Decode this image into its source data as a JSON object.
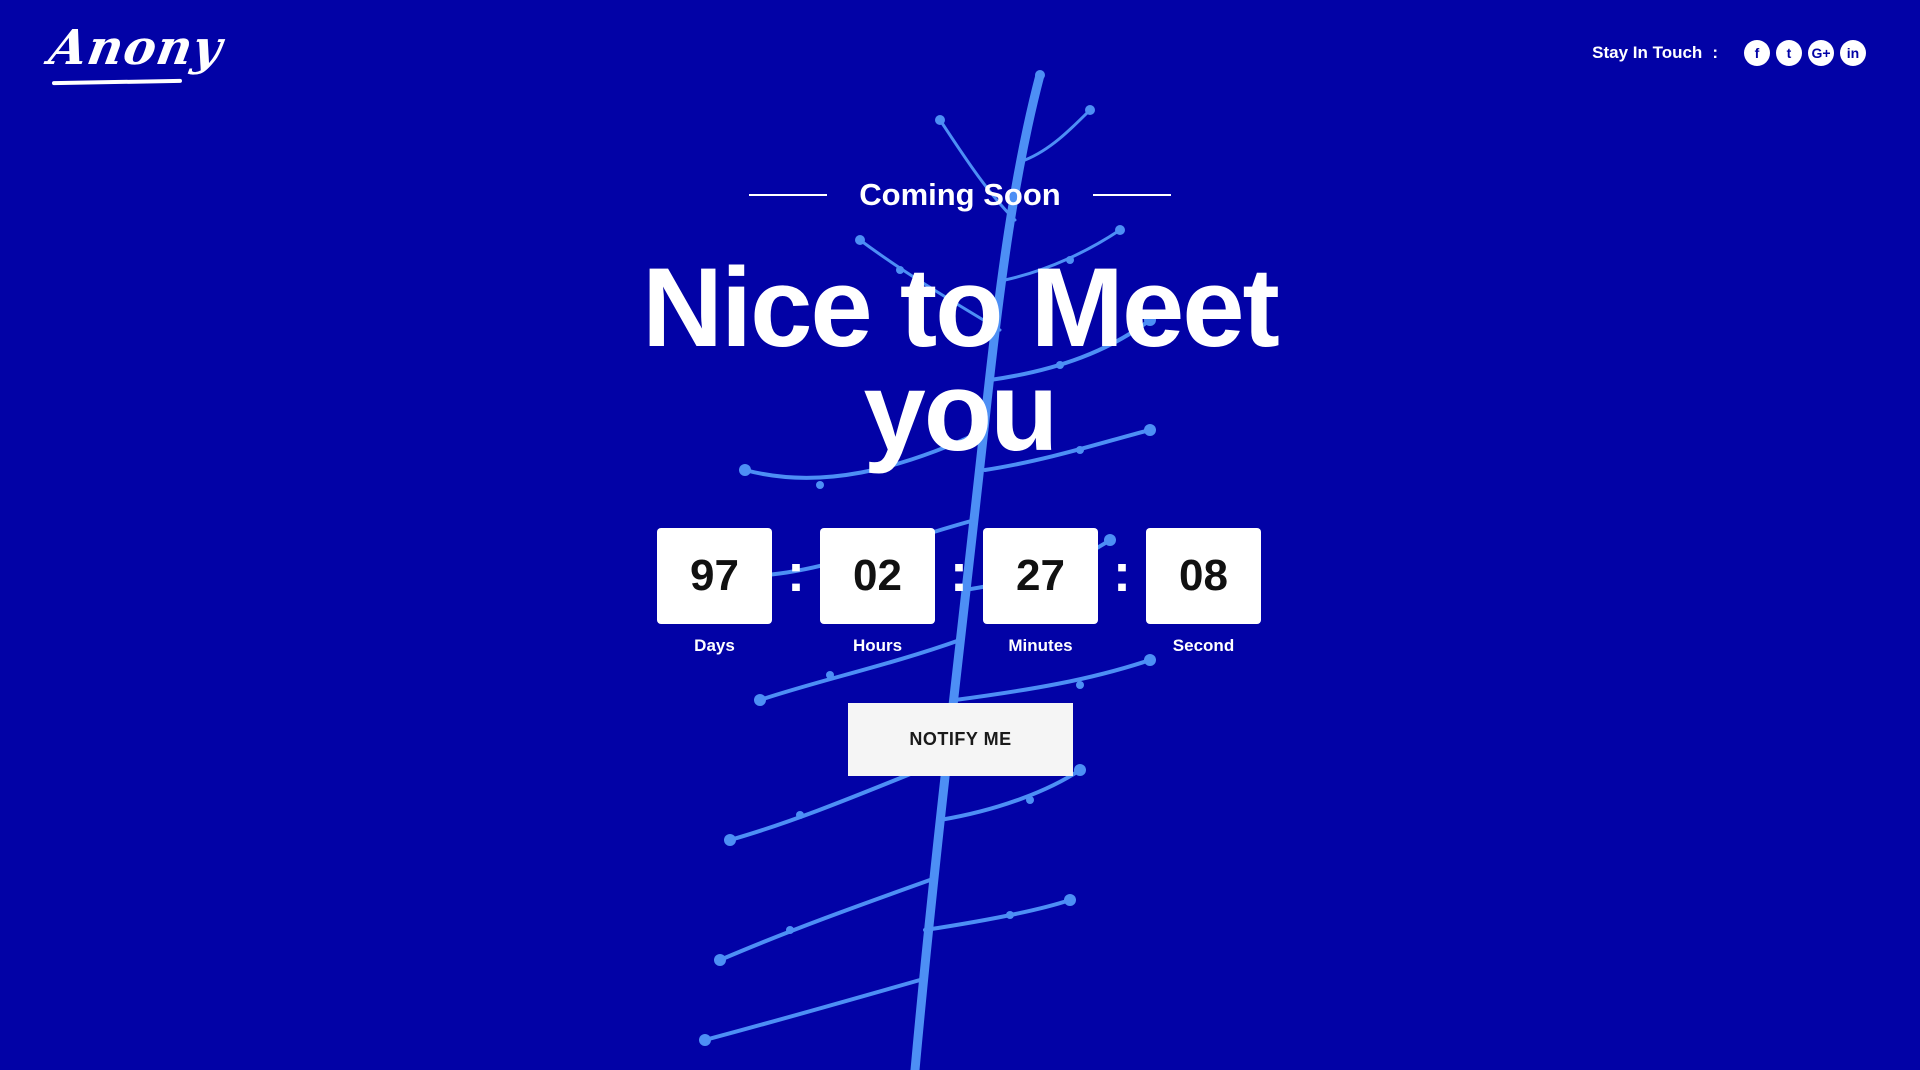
{
  "header": {
    "logo_text": "Anony",
    "social_label": "Stay In Touch",
    "social_separator": ":",
    "social_links": [
      {
        "icon": "facebook-icon",
        "glyph": "f"
      },
      {
        "icon": "twitter-icon",
        "glyph": "t"
      },
      {
        "icon": "google-plus-icon",
        "glyph": "G+"
      },
      {
        "icon": "linkedin-icon",
        "glyph": "in"
      }
    ]
  },
  "hero": {
    "eyebrow": "Coming Soon",
    "headline_line1": "Nice to Meet",
    "headline_line2": "you"
  },
  "countdown": {
    "separator": ":",
    "units": [
      {
        "value": "97",
        "label": "Days"
      },
      {
        "value": "02",
        "label": "Hours"
      },
      {
        "value": "27",
        "label": "Minutes"
      },
      {
        "value": "08",
        "label": "Second"
      }
    ]
  },
  "cta": {
    "label": "NOTIFY ME"
  },
  "colors": {
    "background": "#0202a6",
    "plant": "#4d8ff5",
    "text": "#ffffff",
    "box": "#ffffff",
    "button": "#f5f5f5"
  }
}
